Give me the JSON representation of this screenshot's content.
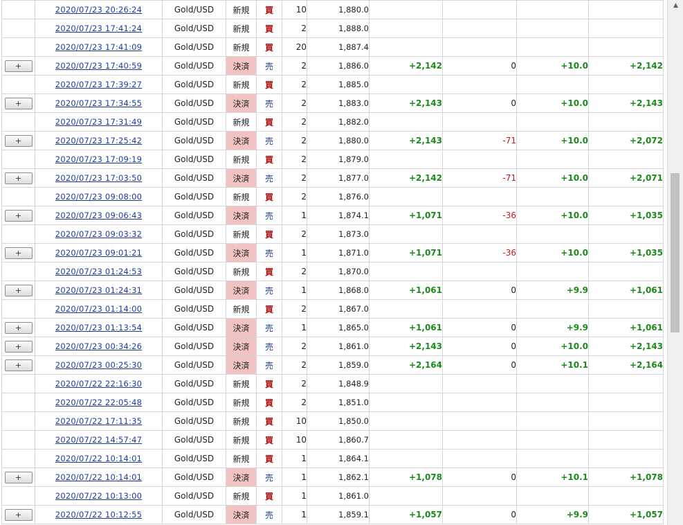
{
  "expand_label": "+",
  "scrollbar": {
    "up_icon": "▲"
  },
  "rows": [
    {
      "date": "2020/07/23 20:26:24",
      "symbol": "Gold/USD",
      "kind": "新規",
      "side": "買",
      "qty": "10",
      "price": "1,880.0",
      "pl": "",
      "swap": "",
      "pips": "",
      "total": ""
    },
    {
      "date": "2020/07/23 17:41:24",
      "symbol": "Gold/USD",
      "kind": "新規",
      "side": "買",
      "qty": "2",
      "price": "1,888.0",
      "pl": "",
      "swap": "",
      "pips": "",
      "total": ""
    },
    {
      "date": "2020/07/23 17:41:09",
      "symbol": "Gold/USD",
      "kind": "新規",
      "side": "買",
      "qty": "20",
      "price": "1,887.4",
      "pl": "",
      "swap": "",
      "pips": "",
      "total": ""
    },
    {
      "date": "2020/07/23 17:40:59",
      "symbol": "Gold/USD",
      "kind": "決済",
      "side": "売",
      "qty": "2",
      "price": "1,886.0",
      "pl": "+2,142",
      "swap": "0",
      "pips": "+10.0",
      "total": "+2,142"
    },
    {
      "date": "2020/07/23 17:39:27",
      "symbol": "Gold/USD",
      "kind": "新規",
      "side": "買",
      "qty": "2",
      "price": "1,885.0",
      "pl": "",
      "swap": "",
      "pips": "",
      "total": ""
    },
    {
      "date": "2020/07/23 17:34:55",
      "symbol": "Gold/USD",
      "kind": "決済",
      "side": "売",
      "qty": "2",
      "price": "1,883.0",
      "pl": "+2,143",
      "swap": "0",
      "pips": "+10.0",
      "total": "+2,143"
    },
    {
      "date": "2020/07/23 17:31:49",
      "symbol": "Gold/USD",
      "kind": "新規",
      "side": "買",
      "qty": "2",
      "price": "1,882.0",
      "pl": "",
      "swap": "",
      "pips": "",
      "total": ""
    },
    {
      "date": "2020/07/23 17:25:42",
      "symbol": "Gold/USD",
      "kind": "決済",
      "side": "売",
      "qty": "2",
      "price": "1,880.0",
      "pl": "+2,143",
      "swap": "-71",
      "pips": "+10.0",
      "total": "+2,072"
    },
    {
      "date": "2020/07/23 17:09:19",
      "symbol": "Gold/USD",
      "kind": "新規",
      "side": "買",
      "qty": "2",
      "price": "1,879.0",
      "pl": "",
      "swap": "",
      "pips": "",
      "total": ""
    },
    {
      "date": "2020/07/23 17:03:50",
      "symbol": "Gold/USD",
      "kind": "決済",
      "side": "売",
      "qty": "2",
      "price": "1,877.0",
      "pl": "+2,142",
      "swap": "-71",
      "pips": "+10.0",
      "total": "+2,071"
    },
    {
      "date": "2020/07/23 09:08:00",
      "symbol": "Gold/USD",
      "kind": "新規",
      "side": "買",
      "qty": "2",
      "price": "1,876.0",
      "pl": "",
      "swap": "",
      "pips": "",
      "total": ""
    },
    {
      "date": "2020/07/23 09:06:43",
      "symbol": "Gold/USD",
      "kind": "決済",
      "side": "売",
      "qty": "1",
      "price": "1,874.1",
      "pl": "+1,071",
      "swap": "-36",
      "pips": "+10.0",
      "total": "+1,035"
    },
    {
      "date": "2020/07/23 09:03:32",
      "symbol": "Gold/USD",
      "kind": "新規",
      "side": "買",
      "qty": "2",
      "price": "1,873.0",
      "pl": "",
      "swap": "",
      "pips": "",
      "total": ""
    },
    {
      "date": "2020/07/23 09:01:21",
      "symbol": "Gold/USD",
      "kind": "決済",
      "side": "売",
      "qty": "1",
      "price": "1,871.0",
      "pl": "+1,071",
      "swap": "-36",
      "pips": "+10.0",
      "total": "+1,035"
    },
    {
      "date": "2020/07/23 01:24:53",
      "symbol": "Gold/USD",
      "kind": "新規",
      "side": "買",
      "qty": "2",
      "price": "1,870.0",
      "pl": "",
      "swap": "",
      "pips": "",
      "total": ""
    },
    {
      "date": "2020/07/23 01:24:31",
      "symbol": "Gold/USD",
      "kind": "決済",
      "side": "売",
      "qty": "1",
      "price": "1,868.0",
      "pl": "+1,061",
      "swap": "0",
      "pips": "+9.9",
      "total": "+1,061"
    },
    {
      "date": "2020/07/23 01:14:00",
      "symbol": "Gold/USD",
      "kind": "新規",
      "side": "買",
      "qty": "2",
      "price": "1,867.0",
      "pl": "",
      "swap": "",
      "pips": "",
      "total": ""
    },
    {
      "date": "2020/07/23 01:13:54",
      "symbol": "Gold/USD",
      "kind": "決済",
      "side": "売",
      "qty": "1",
      "price": "1,865.0",
      "pl": "+1,061",
      "swap": "0",
      "pips": "+9.9",
      "total": "+1,061"
    },
    {
      "date": "2020/07/23 00:34:26",
      "symbol": "Gold/USD",
      "kind": "決済",
      "side": "売",
      "qty": "2",
      "price": "1,861.0",
      "pl": "+2,143",
      "swap": "0",
      "pips": "+10.0",
      "total": "+2,143"
    },
    {
      "date": "2020/07/23 00:25:30",
      "symbol": "Gold/USD",
      "kind": "決済",
      "side": "売",
      "qty": "2",
      "price": "1,859.0",
      "pl": "+2,164",
      "swap": "0",
      "pips": "+10.1",
      "total": "+2,164"
    },
    {
      "date": "2020/07/22 22:16:30",
      "symbol": "Gold/USD",
      "kind": "新規",
      "side": "買",
      "qty": "2",
      "price": "1,848.9",
      "pl": "",
      "swap": "",
      "pips": "",
      "total": ""
    },
    {
      "date": "2020/07/22 22:05:48",
      "symbol": "Gold/USD",
      "kind": "新規",
      "side": "買",
      "qty": "2",
      "price": "1,851.0",
      "pl": "",
      "swap": "",
      "pips": "",
      "total": ""
    },
    {
      "date": "2020/07/22 17:11:35",
      "symbol": "Gold/USD",
      "kind": "新規",
      "side": "買",
      "qty": "10",
      "price": "1,850.0",
      "pl": "",
      "swap": "",
      "pips": "",
      "total": ""
    },
    {
      "date": "2020/07/22 14:57:47",
      "symbol": "Gold/USD",
      "kind": "新規",
      "side": "買",
      "qty": "10",
      "price": "1,860.7",
      "pl": "",
      "swap": "",
      "pips": "",
      "total": ""
    },
    {
      "date": "2020/07/22 10:14:01",
      "symbol": "Gold/USD",
      "kind": "新規",
      "side": "買",
      "qty": "1",
      "price": "1,864.1",
      "pl": "",
      "swap": "",
      "pips": "",
      "total": ""
    },
    {
      "date": "2020/07/22 10:14:01",
      "symbol": "Gold/USD",
      "kind": "決済",
      "side": "売",
      "qty": "1",
      "price": "1,862.1",
      "pl": "+1,078",
      "swap": "0",
      "pips": "+10.1",
      "total": "+1,078"
    },
    {
      "date": "2020/07/22 10:13:00",
      "symbol": "Gold/USD",
      "kind": "新規",
      "side": "買",
      "qty": "1",
      "price": "1,861.0",
      "pl": "",
      "swap": "",
      "pips": "",
      "total": ""
    },
    {
      "date": "2020/07/22 10:12:55",
      "symbol": "Gold/USD",
      "kind": "決済",
      "side": "売",
      "qty": "1",
      "price": "1,859.1",
      "pl": "+1,057",
      "swap": "0",
      "pips": "+9.9",
      "total": "+1,057"
    }
  ]
}
